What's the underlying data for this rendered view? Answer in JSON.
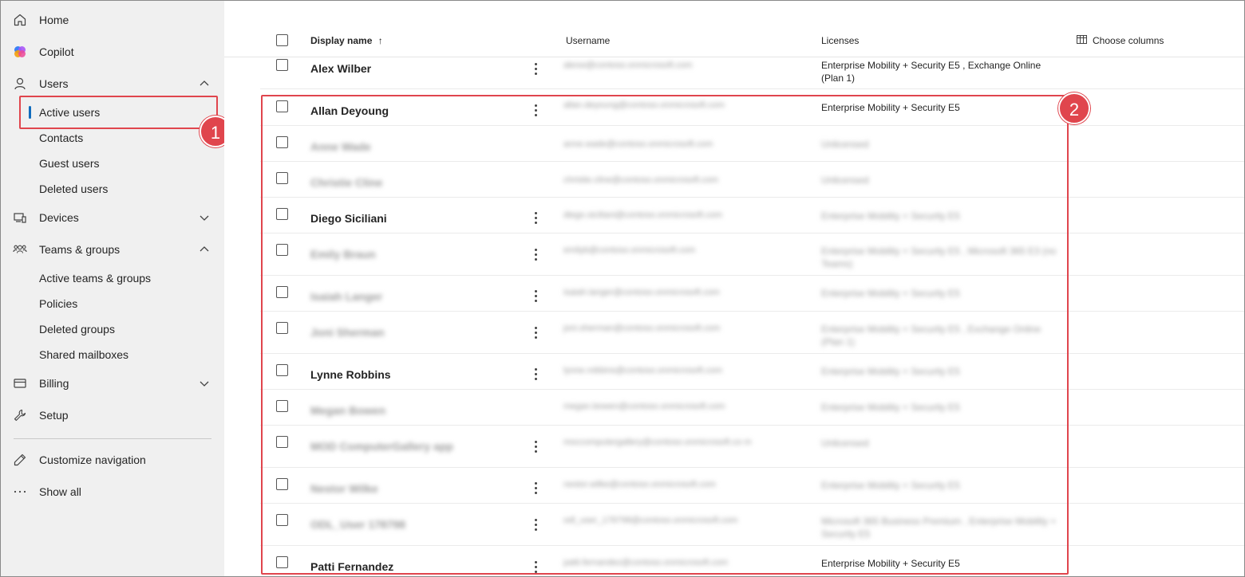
{
  "nav": {
    "home": "Home",
    "copilot": "Copilot",
    "users": "Users",
    "active_users": "Active users",
    "contacts": "Contacts",
    "guest_users": "Guest users",
    "deleted_users": "Deleted users",
    "devices": "Devices",
    "teams_groups": "Teams & groups",
    "active_teams_groups": "Active teams & groups",
    "policies": "Policies",
    "deleted_groups": "Deleted groups",
    "shared_mailboxes": "Shared mailboxes",
    "billing": "Billing",
    "setup": "Setup",
    "customize_navigation": "Customize navigation",
    "show_all": "Show all"
  },
  "callouts": {
    "one": "1",
    "two": "2"
  },
  "table": {
    "headers": {
      "display_name": "Display name",
      "sort_indicator": "↑",
      "username": "Username",
      "licenses": "Licenses",
      "choose_columns": "Choose columns"
    },
    "rows": [
      {
        "name": "Alex Wilber",
        "username": "alexw@contoso.onmicrosoft.com",
        "licenses": "Enterprise Mobility + Security E5 , Exchange Online (Plan 1)"
      },
      {
        "name": "Allan Deyoung",
        "username": "allan.deyoung@contoso.onmicrosoft.com",
        "licenses": "Enterprise Mobility + Security E5"
      },
      {
        "name": "Anne Wade",
        "username": "anne.wade@contoso.onmicrosoft.com",
        "licenses": "Unlicensed"
      },
      {
        "name": "Christie Cline",
        "username": "christie.cline@contoso.onmicrosoft.com",
        "licenses": "Unlicensed"
      },
      {
        "name": "Diego Siciliani",
        "username": "diego.siciliani@contoso.onmicrosoft.com",
        "licenses": "Enterprise Mobility + Security E5"
      },
      {
        "name": "Emily Braun",
        "username": "emilyb@contoso.onmicrosoft.com",
        "licenses": "Enterprise Mobility + Security E5 , Microsoft 365 E3 (no Teams)"
      },
      {
        "name": "Isaiah Langer",
        "username": "isaiah.langer@contoso.onmicrosoft.com",
        "licenses": "Enterprise Mobility + Security E5"
      },
      {
        "name": "Joni Sherman",
        "username": "joni.sherman@contoso.onmicrosoft.com",
        "licenses": "Enterprise Mobility + Security E5 , Exchange Online (Plan 1)"
      },
      {
        "name": "Lynne Robbins",
        "username": "lynne.robbins@contoso.onmicrosoft.com",
        "licenses": "Enterprise Mobility + Security E5"
      },
      {
        "name": "Megan Bowen",
        "username": "megan.bowen@contoso.onmicrosoft.com",
        "licenses": "Enterprise Mobility + Security E5"
      },
      {
        "name": "MOD ComputerGallery app",
        "username": "moccomputergallery@contoso.onmicrosoft.co m",
        "licenses": "Unlicensed"
      },
      {
        "name": "Nestor Wilke",
        "username": "nestor.wilke@contoso.onmicrosoft.com",
        "licenses": "Enterprise Mobility + Security E5"
      },
      {
        "name": "ODL_User 178798",
        "username": "odl_user_178798@contoso.onmicrosoft.com",
        "licenses": "Microsoft 365 Business Premium , Enterprise Mobility + Security E5"
      },
      {
        "name": "Patti Fernandez",
        "username": "patti.fernandez@contoso.onmicrosoft.com",
        "licenses": "Enterprise Mobility + Security E5"
      }
    ]
  },
  "colors": {
    "accent": "#0f6cbd",
    "callout": "#e0454d",
    "sidebar_bg": "#f0f0f0"
  }
}
